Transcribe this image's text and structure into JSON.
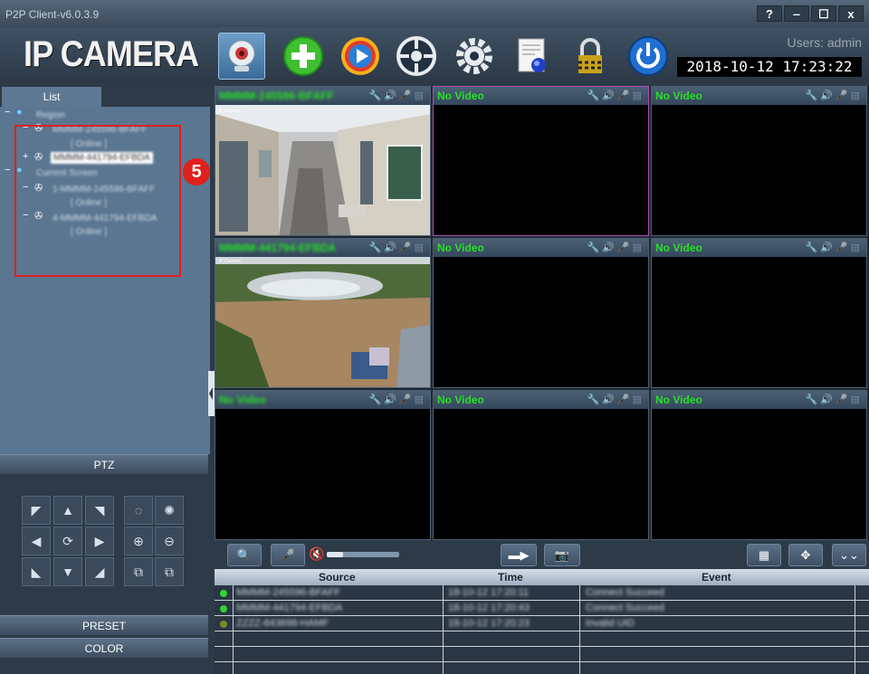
{
  "window": {
    "title": "P2P Client-v6.0.3.9",
    "help_label": "?",
    "minimize_label": "‒",
    "maximize_label": "☐",
    "close_label": "x"
  },
  "header": {
    "logo": "IP CAMERA",
    "users": "Users: admin",
    "datetime": "2018-10-12 17:23:22",
    "toolbar": [
      "camera-preview",
      "add-device",
      "playback",
      "ptz-control",
      "settings",
      "log",
      "lock",
      "power"
    ]
  },
  "sidebar": {
    "list_tab": "List",
    "tree": [
      {
        "text": "Region",
        "level": 0
      },
      {
        "text": "MMMM-245596-BFAFF",
        "level": 1
      },
      {
        "text": "[ Online ]",
        "level": 2
      },
      {
        "text": "MMMM-441794-EFBDA",
        "level": 1
      },
      {
        "text": "Current Screen",
        "level": 0
      },
      {
        "text": "1-MMMM-245596-BFAFF",
        "level": 1
      },
      {
        "text": "[ Online ]",
        "level": 2
      },
      {
        "text": "4-MMMM-441794-EFBDA",
        "level": 1
      },
      {
        "text": "[ Online ]",
        "level": 2
      }
    ],
    "annotation_number": "5",
    "ptz_label": "PTZ",
    "preset_label": "PRESET",
    "color_label": "COLOR"
  },
  "grid": {
    "cells": [
      {
        "label": "MMMM-245596-BFAFF",
        "blurred": true,
        "video": "yard"
      },
      {
        "label": "No Video",
        "blurred": false,
        "selected": true
      },
      {
        "label": "No Video",
        "blurred": false
      },
      {
        "label": "MMMM-441794-EFBDA",
        "blurred": true,
        "video": "pond"
      },
      {
        "label": "No Video",
        "blurred": false
      },
      {
        "label": "No Video",
        "blurred": false
      },
      {
        "label": "No Video",
        "blurred": true
      },
      {
        "label": "No Video",
        "blurred": false
      },
      {
        "label": "No Video",
        "blurred": false
      }
    ]
  },
  "log": {
    "columns": [
      "Source",
      "Time",
      "Event"
    ],
    "rows": [
      {
        "source": "MMMM-245596-BFAFF",
        "time": "18-10-12 17:20:11",
        "event": "Connect Succeed",
        "status": "green"
      },
      {
        "source": "MMMM-441794-EFBDA",
        "time": "18-10-12 17:20:43",
        "event": "Connect Succeed",
        "status": "green"
      },
      {
        "source": "ZZZZ-843698-HAMF",
        "time": "18-10-12 17:20:23",
        "event": "Invalid UID",
        "status": "olive"
      }
    ]
  },
  "colors": {
    "accent_green": "#28e028",
    "highlight_red": "#e0201c",
    "selection_purple": "#b04fb4"
  }
}
